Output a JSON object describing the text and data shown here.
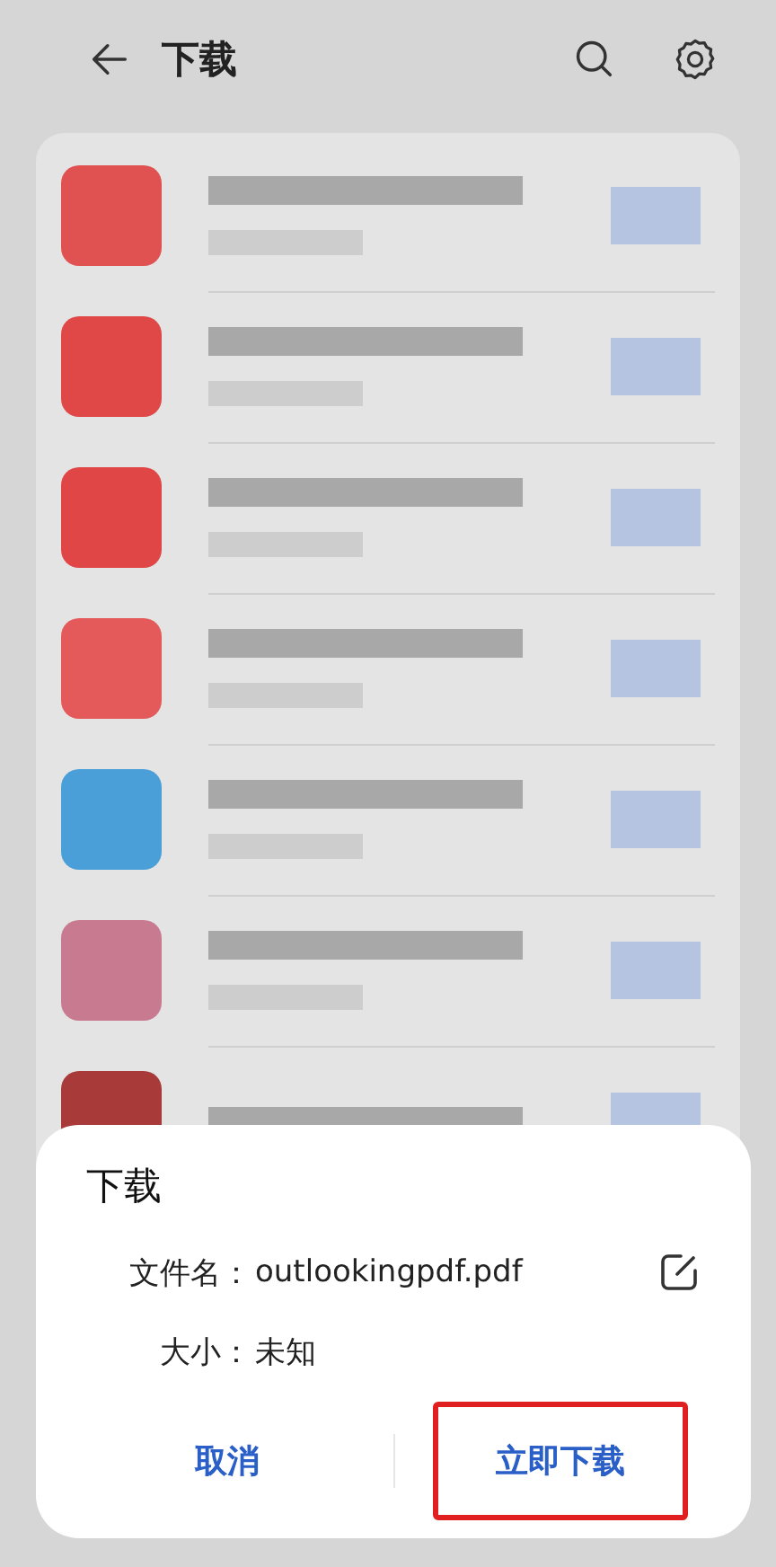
{
  "header": {
    "title": "下载"
  },
  "list": {
    "rows": [
      {
        "color": "#e05252"
      },
      {
        "color": "#e04848"
      },
      {
        "color": "#e04646"
      },
      {
        "color": "#e45a5a"
      },
      {
        "color": "#4a9fd8"
      },
      {
        "color": "#c87a90"
      },
      {
        "color": "#a83a3a"
      }
    ]
  },
  "dialog": {
    "title": "下载",
    "fields": [
      {
        "label": "文件名：",
        "value": "outlookingpdf.pdf",
        "editable": true
      },
      {
        "label": "大小：",
        "value": "未知",
        "editable": false
      }
    ],
    "buttons": [
      {
        "label": "取消",
        "highlighted": false
      },
      {
        "label": "立即下载",
        "highlighted": true
      }
    ]
  }
}
